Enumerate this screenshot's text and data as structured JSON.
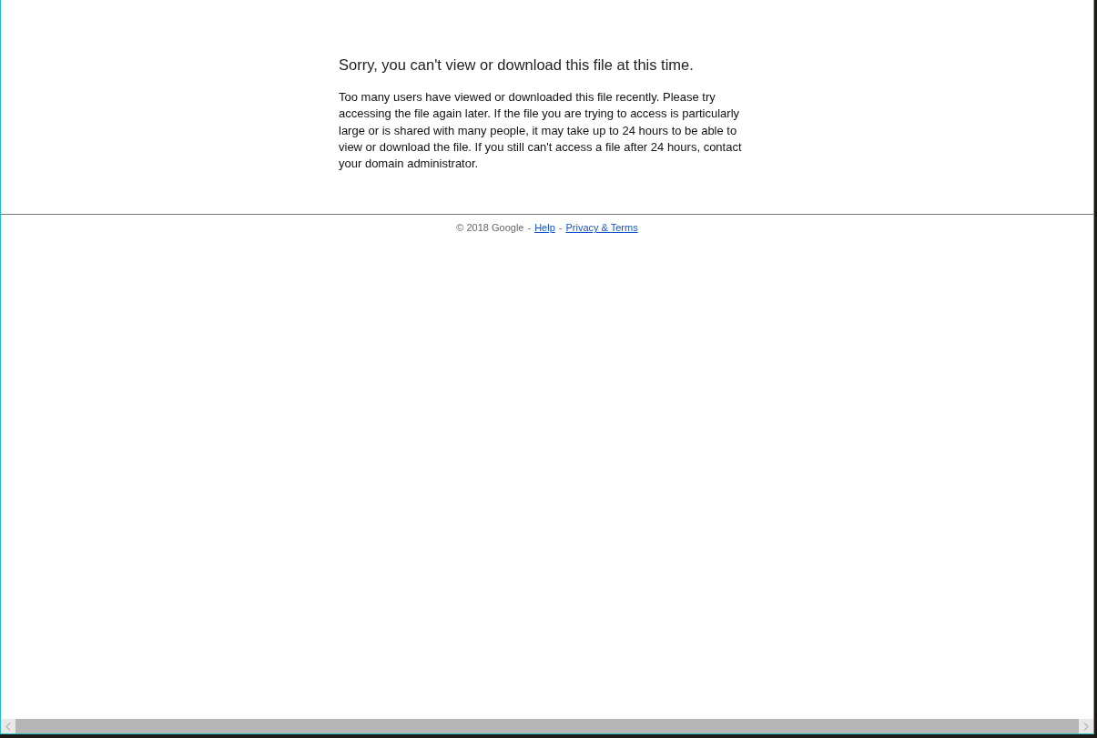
{
  "message": {
    "title": "Sorry, you can't view or download this file at this time.",
    "body": "Too many users have viewed or downloaded this file recently. Please try accessing the file again later. If the file you are trying to access is particularly large or is shared with many people, it may take up to 24 hours to be able to view or download the file. If you still can't access a file after 24 hours, contact your domain administrator."
  },
  "footer": {
    "copyright": "© 2018 Google",
    "separator_1": "-",
    "help_link": "Help",
    "separator_2": "-",
    "privacy_link": "Privacy & Terms"
  }
}
